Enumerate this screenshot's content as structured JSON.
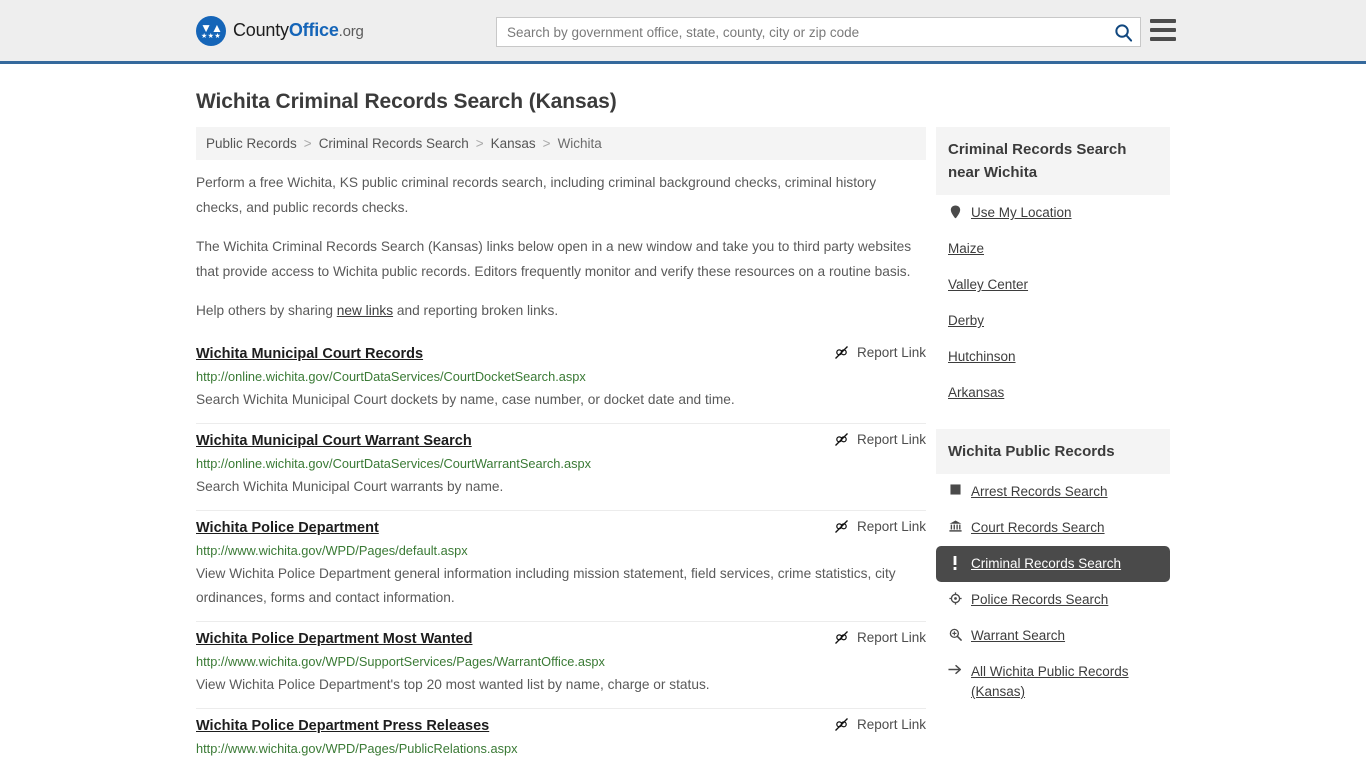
{
  "header": {
    "brand": {
      "part1": "County",
      "part2": "Office",
      "part3": ".org",
      "mark_icon": "eagle-seal-icon"
    },
    "search": {
      "placeholder": "Search by government office, state, county, city or zip code",
      "value": "",
      "button_icon": "search-icon"
    },
    "menu_icon": "hamburger-menu-icon",
    "accent_color": "#35699c"
  },
  "page": {
    "title": "Wichita Criminal Records Search (Kansas)"
  },
  "breadcrumb": {
    "items": [
      {
        "label": "Public Records",
        "current": false
      },
      {
        "label": "Criminal Records Search",
        "current": false
      },
      {
        "label": "Kansas",
        "current": false
      },
      {
        "label": "Wichita",
        "current": true
      }
    ],
    "separator": ">"
  },
  "intro": {
    "p1": "Perform a free Wichita, KS public criminal records search, including criminal background checks, criminal history checks, and public records checks.",
    "p2": "The Wichita Criminal Records Search (Kansas) links below open in a new window and take you to third party websites that provide access to Wichita public records. Editors frequently monitor and verify these resources on a routine basis.",
    "p3_before": "Help others by sharing ",
    "p3_link": "new links",
    "p3_after": " and reporting broken links."
  },
  "report_link_label": "Report Link",
  "report_link_icon": "broken-link-icon",
  "links": [
    {
      "title": "Wichita Municipal Court Records",
      "url": "http://online.wichita.gov/CourtDataServices/CourtDocketSearch.aspx",
      "desc": "Search Wichita Municipal Court dockets by name, case number, or docket date and time.",
      "report": "Report Link"
    },
    {
      "title": "Wichita Municipal Court Warrant Search",
      "url": "http://online.wichita.gov/CourtDataServices/CourtWarrantSearch.aspx",
      "desc": "Search Wichita Municipal Court warrants by name.",
      "report": "Report Link"
    },
    {
      "title": "Wichita Police Department",
      "url": "http://www.wichita.gov/WPD/Pages/default.aspx",
      "desc": "View Wichita Police Department general information including mission statement, field services, crime statistics, city ordinances, forms and contact information.",
      "report": "Report Link"
    },
    {
      "title": "Wichita Police Department Most Wanted",
      "url": "http://www.wichita.gov/WPD/SupportServices/Pages/WarrantOffice.aspx",
      "desc": "View Wichita Police Department's top 20 most wanted list by name, charge or status.",
      "report": "Report Link"
    },
    {
      "title": "Wichita Police Department Press Releases",
      "url": "http://www.wichita.gov/WPD/Pages/PublicRelations.aspx",
      "desc": "",
      "report": "Report Link"
    }
  ],
  "sidebar": {
    "near": {
      "heading": "Criminal Records Search near Wichita",
      "items": [
        {
          "label": "Use My Location",
          "icon": "map-pin-icon",
          "active": false
        },
        {
          "label": "Maize",
          "icon": "",
          "active": false
        },
        {
          "label": "Valley Center",
          "icon": "",
          "active": false
        },
        {
          "label": "Derby",
          "icon": "",
          "active": false
        },
        {
          "label": "Hutchinson",
          "icon": "",
          "active": false
        },
        {
          "label": "Arkansas",
          "icon": "",
          "active": false
        }
      ]
    },
    "public_records": {
      "heading": "Wichita Public Records",
      "items": [
        {
          "label": "Arrest Records Search",
          "icon": "fingerprint-square-icon",
          "active": false
        },
        {
          "label": "Court Records Search",
          "icon": "courthouse-icon",
          "active": false
        },
        {
          "label": "Criminal Records Search",
          "icon": "exclamation-icon",
          "active": true
        },
        {
          "label": "Police Records Search",
          "icon": "police-badge-icon",
          "active": false
        },
        {
          "label": "Warrant Search",
          "icon": "magnifier-plus-icon",
          "active": false
        },
        {
          "label": "All Wichita Public Records (Kansas)",
          "icon": "arrow-right-icon",
          "active": false
        }
      ],
      "active_bg": "#4a4a4a"
    }
  }
}
